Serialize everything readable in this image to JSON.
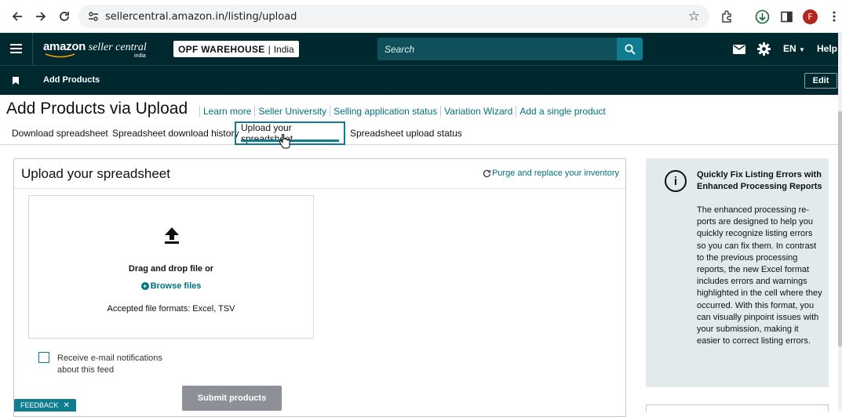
{
  "browser": {
    "url": "sellercentral.amazon.in/listing/upload",
    "profile_initial": "F"
  },
  "header": {
    "brand": "amazon",
    "brand_suffix": " seller central",
    "brand_region": "india",
    "store_name": "OPF WAREHOUSE",
    "store_sep": "|",
    "store_region": "India",
    "search_placeholder": "Search",
    "language": "EN",
    "help_label": "Help"
  },
  "subheader": {
    "title": "Add Products",
    "edit_label": "Edit"
  },
  "page": {
    "title": "Add Products via Upload",
    "links": [
      "Learn more",
      "Seller University",
      "Selling application status",
      "Variation Wizard",
      "Add a single product"
    ]
  },
  "tabs": [
    {
      "label": "Download spreadsheet"
    },
    {
      "label": "Spreadsheet download history"
    },
    {
      "label": "Upload your spreadsheet"
    },
    {
      "label": "Spreadsheet upload status"
    }
  ],
  "upload": {
    "title": "Upload your spreadsheet",
    "purge_label": "Purge and replace your inventory",
    "drag_text": "Drag and drop file or",
    "browse_label": "Browse files",
    "formats_text": "Accepted file formats: Excel, TSV",
    "notify_label": "Receive e-mail notifications about this feed",
    "notify_checked": false,
    "submit_label": "Submit products"
  },
  "info_panel": {
    "title": "Quickly Fix Listing Errors with Enhanced Processing Reports",
    "body": "The enhanced processing re-ports are designed to help you quickly recognize listing errors so you can fix them. In contrast to the previous processing reports, the new Excel format includes errors and warnings highlighted in the cell where they occurred. With this format, you can visually pinpoint issues with your submission, making it easier to correct listing errors."
  },
  "feedback": {
    "label": "FEEDBACK",
    "close": "✕"
  },
  "colors": {
    "header_bg": "#00282f",
    "accent": "#0f7c90",
    "link": "#007185",
    "info_bg": "#e3eaec"
  }
}
